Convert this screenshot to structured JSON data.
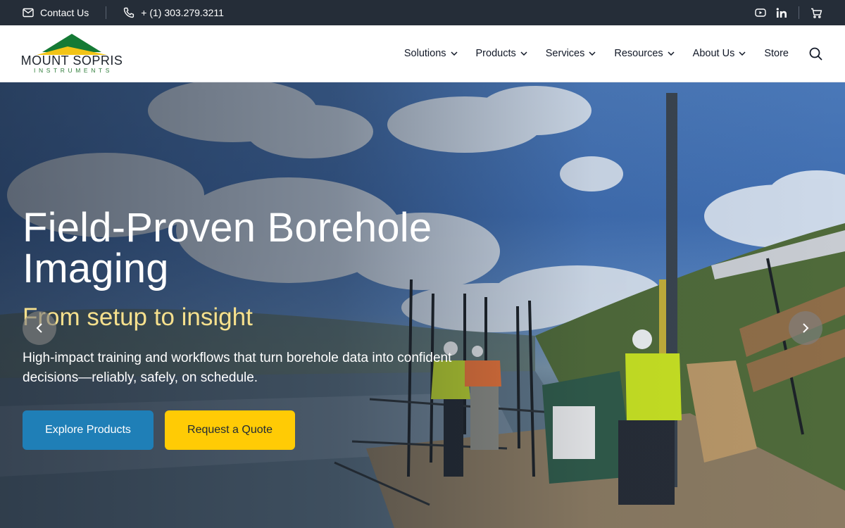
{
  "topbar": {
    "contact_label": "Contact Us",
    "phone_label": "+ (1) 303.279.3211"
  },
  "brand": {
    "name": "MOUNT SOPRIS",
    "sub": "INSTRUMENTS",
    "colors": {
      "green": "#157a35",
      "yellow": "#f2c417",
      "teal": "#1f7fb7"
    }
  },
  "nav": {
    "items": [
      {
        "label": "Solutions"
      },
      {
        "label": "Products"
      },
      {
        "label": "Services"
      },
      {
        "label": "Resources"
      },
      {
        "label": "About Us"
      }
    ],
    "store_label": "Store"
  },
  "hero": {
    "title": "Field-Proven Borehole Imaging",
    "subtitle": "From setup to insight",
    "description": "High-impact training and workflows that turn borehole data into confident decisions—reliably, safely, on schedule.",
    "primary_cta": "Explore Products",
    "secondary_cta": "Request a Quote"
  }
}
